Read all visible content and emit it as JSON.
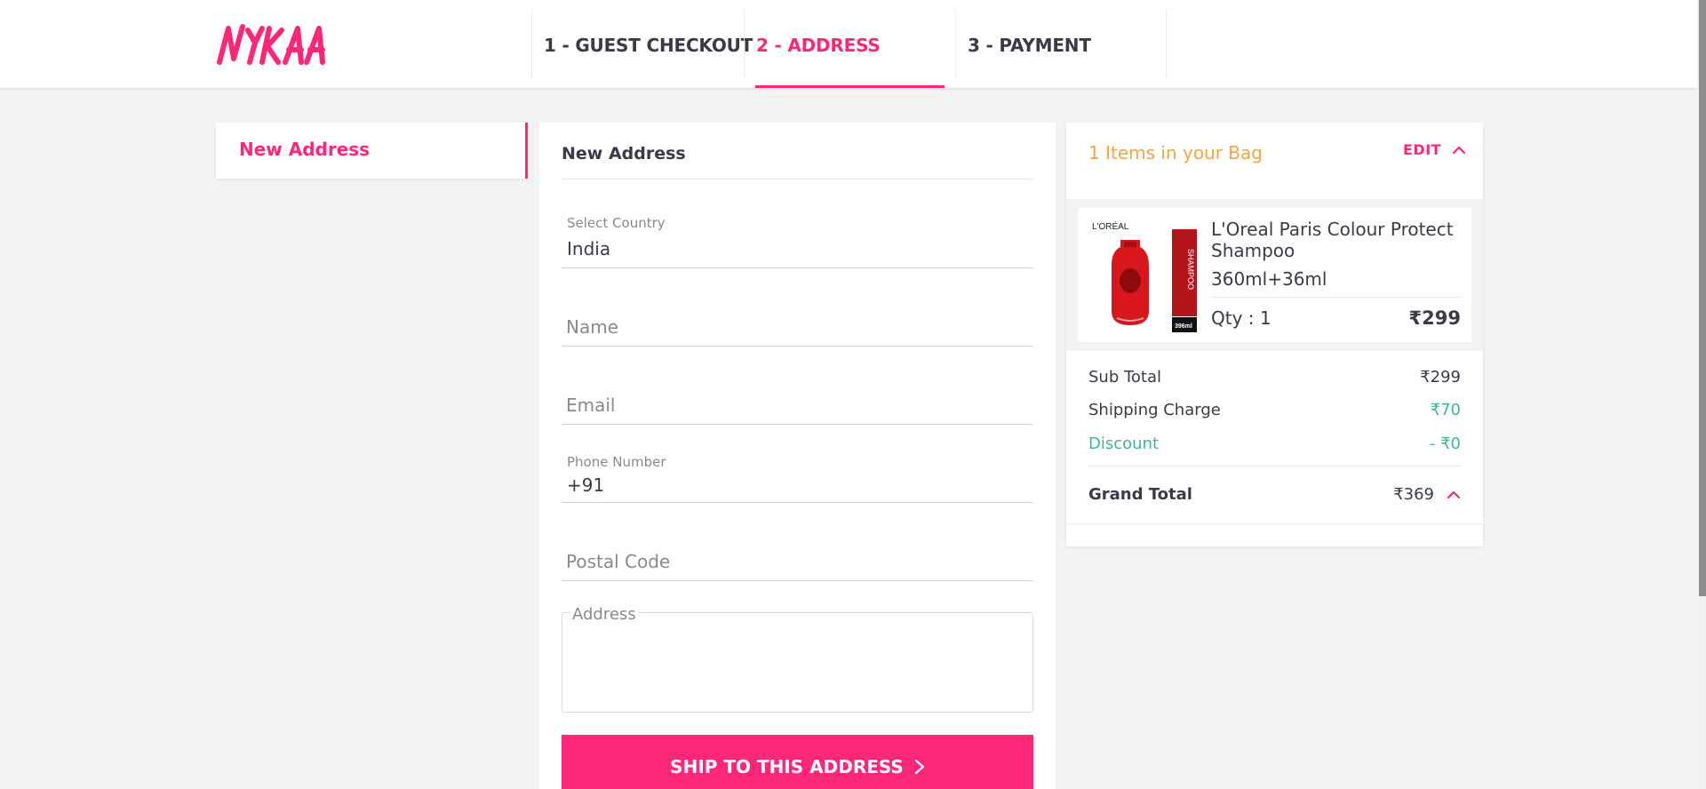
{
  "brand": {
    "name": "NYKAA",
    "color": "#fc2779"
  },
  "steps": [
    {
      "label": "1 - GUEST CHECKOUT",
      "active": false
    },
    {
      "label": "2 - ADDRESS",
      "active": true
    },
    {
      "label": "3 - PAYMENT",
      "active": false
    }
  ],
  "addresses": {
    "new_address_label": "New Address"
  },
  "form": {
    "title": "New Address",
    "country": {
      "label": "Select Country",
      "value": "India"
    },
    "name": {
      "placeholder": "Name"
    },
    "email": {
      "placeholder": "Email"
    },
    "phone": {
      "label": "Phone Number",
      "prefix": "+91"
    },
    "postal": {
      "placeholder": "Postal Code"
    },
    "address": {
      "label": "Address"
    },
    "submit_label": "SHIP TO THIS ADDRESS",
    "submit_icon": "chevron-right-icon"
  },
  "bag": {
    "title": "1 Items in your Bag",
    "edit_label": "EDIT",
    "items": [
      {
        "name": "L'Oreal Paris Colour Protect Shampoo",
        "size": "360ml+36ml",
        "qty_label": "Qty :  1",
        "price": "₹299",
        "image_text": {
          "brand": "L'ORÉAL",
          "side": "SHAMPOO",
          "badge": "396ml"
        }
      }
    ],
    "summary": {
      "subtotal": {
        "label": "Sub Total",
        "value": "₹299"
      },
      "shipping": {
        "label": "Shipping Charge",
        "value": "₹70"
      },
      "discount": {
        "label": "Discount",
        "value": "- ₹0"
      },
      "grand_total": {
        "label": "Grand Total",
        "value": "₹369"
      }
    },
    "colors": {
      "title": "#f6a341",
      "green": "#3eb59a"
    }
  }
}
